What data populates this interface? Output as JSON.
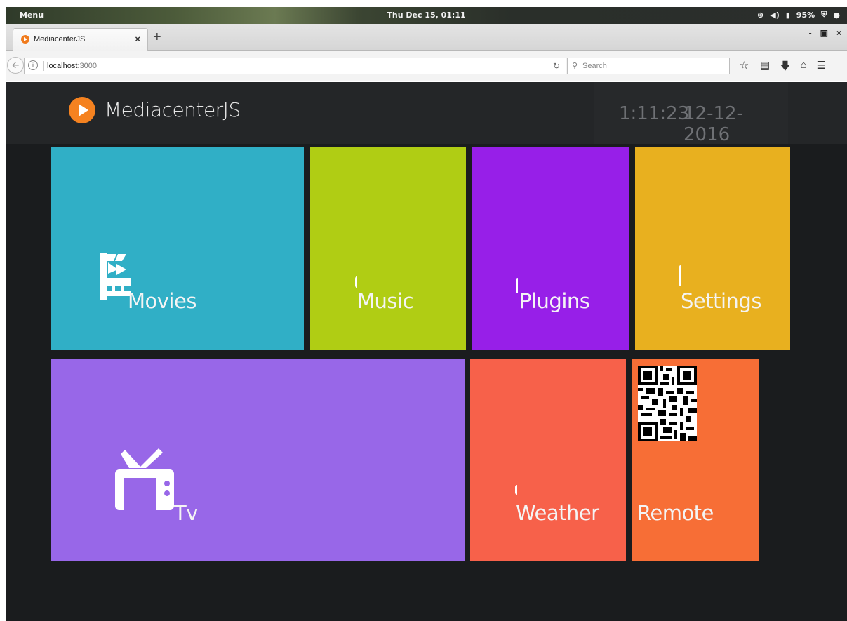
{
  "desktop": {
    "menu_label": "Menu",
    "clock": "Thu Dec 15, 01:11",
    "battery": "95%"
  },
  "browser": {
    "tab_title": "MediacenterJS",
    "tab_close": "×",
    "new_tab": "+",
    "url_host": "localhost",
    "url_port": ":3000",
    "search_placeholder": "Search",
    "window_controls": [
      "-",
      "▣",
      "×"
    ]
  },
  "app": {
    "brand": "MediacenterJS",
    "time": "1:11:23",
    "date": "12-12-2016",
    "tiles": {
      "movies": "Movies",
      "music": "Music",
      "plugins": "Plugins",
      "settings": "Settings",
      "tv": "Tv",
      "weather": "Weather",
      "remote": "Remote"
    }
  },
  "colors": {
    "movies": "#30afc6",
    "music": "#b0cd14",
    "plugins": "#971fe8",
    "settings": "#e8b01f",
    "tv": "#9867e8",
    "weather": "#f7614a",
    "remote": "#f76e36",
    "logo": "#f58220"
  }
}
